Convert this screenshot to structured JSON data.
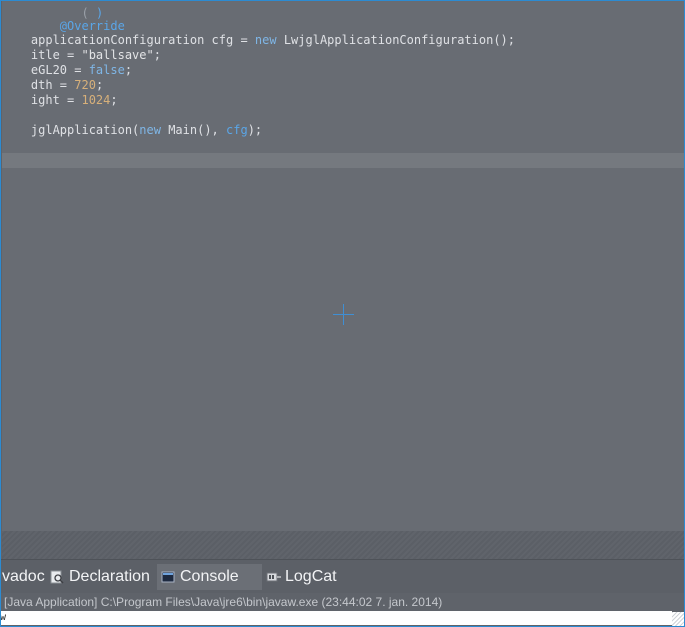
{
  "code": {
    "line0": {
      "a": "applicationConfiguration ",
      "b": "cfg",
      "c": " = ",
      "d": "new",
      "e": " LwjglApplicationConfiguration();"
    },
    "line1": {
      "a": "itle = ",
      "b": "\"ballsave\"",
      "c": ";"
    },
    "line2": {
      "a": "eGL20 = ",
      "b": "false",
      "c": ";"
    },
    "line3": {
      "a": "dth = ",
      "b": "720",
      "c": ";"
    },
    "line4": {
      "a": "ight = ",
      "b": "1024",
      "c": ";"
    },
    "line5": {
      "a": "jglApplication(",
      "b": "new",
      "c": " Main(), ",
      "d": "cfg",
      "e": ");"
    }
  },
  "tabs": [
    {
      "label": "vadoc",
      "icon": "javadoc-icon"
    },
    {
      "label": "Declaration",
      "icon": "declaration-icon"
    },
    {
      "label": "Console",
      "icon": "console-icon"
    },
    {
      "label": "LogCat",
      "icon": "logcat-icon"
    }
  ],
  "console": {
    "launch_info": "[Java Application] C:\\Program Files\\Java\\jre6\\bin\\javaw.exe (23:44:02 7. jan. 2014)",
    "output": "w"
  },
  "colors": {
    "editor_bg": "#686c73",
    "keyword": "#7fb6e6",
    "number": "#d7b07a",
    "accent": "#2c8bd2"
  }
}
